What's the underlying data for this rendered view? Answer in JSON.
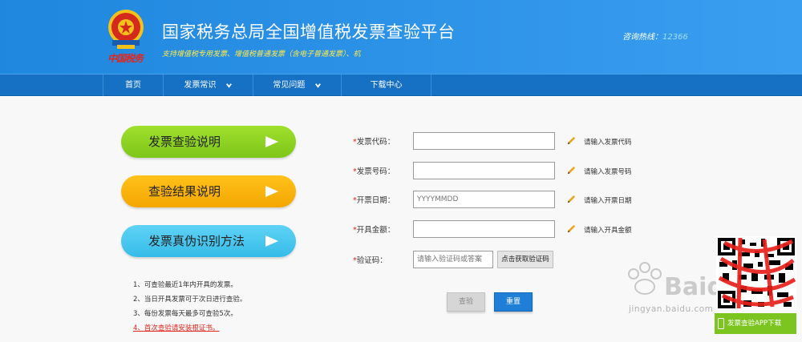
{
  "header": {
    "title": "国家税务总局全国增值税发票查验平台",
    "subtitle": "支持增值税专用发票、增值税普通发票（含电子普通发票）、机",
    "brand_signature": "中国税务",
    "hotline_label": "咨询热线：",
    "hotline_number": "12366"
  },
  "nav": {
    "items": [
      {
        "label": "首页",
        "has_dropdown": false
      },
      {
        "label": "发票常识",
        "has_dropdown": true
      },
      {
        "label": "常见问题",
        "has_dropdown": true
      },
      {
        "label": "下载中心",
        "has_dropdown": false
      }
    ]
  },
  "side_buttons": [
    {
      "label": "发票查验说明",
      "color": "#8fd626"
    },
    {
      "label": "查验结果说明",
      "color": "#fbb40f"
    },
    {
      "label": "发票真伪识别方法",
      "color": "#4ac7ef"
    }
  ],
  "notes": [
    "1、可查验最近1年内开具的发票。",
    "2、当日开具发票可于次日进行查验。",
    "3、每份发票每天最多可查验5次。",
    "4、首次查验请安装根证书。"
  ],
  "form": {
    "required_mark": "*",
    "fields": [
      {
        "label": "发票代码：",
        "value": "",
        "placeholder": "",
        "hint": "请输入发票代码"
      },
      {
        "label": "发票号码：",
        "value": "",
        "placeholder": "",
        "hint": "请输入发票号码"
      },
      {
        "label": "开票日期：",
        "value": "",
        "placeholder": "YYYYMMDD",
        "hint": "请输入开票日期"
      },
      {
        "label": "开具金额：",
        "value": "",
        "placeholder": "",
        "hint": "请输入开具金额"
      }
    ],
    "captcha": {
      "label": "验证码：",
      "placeholder": "请输入验证码或答案",
      "button": "点击获取验证码"
    },
    "query_button": "查验",
    "reset_button": "重置"
  },
  "app_download": "发票查验APP下载",
  "watermark": {
    "text_main": "Baidu经验",
    "text_sub": "jingyan.baidu.com"
  },
  "colors": {
    "header_blue": "#2b93e8",
    "nav_blue": "#1670c4",
    "required_red": "#e0241b",
    "reset_blue": "#1f7fd6",
    "app_green": "#7cc520"
  }
}
